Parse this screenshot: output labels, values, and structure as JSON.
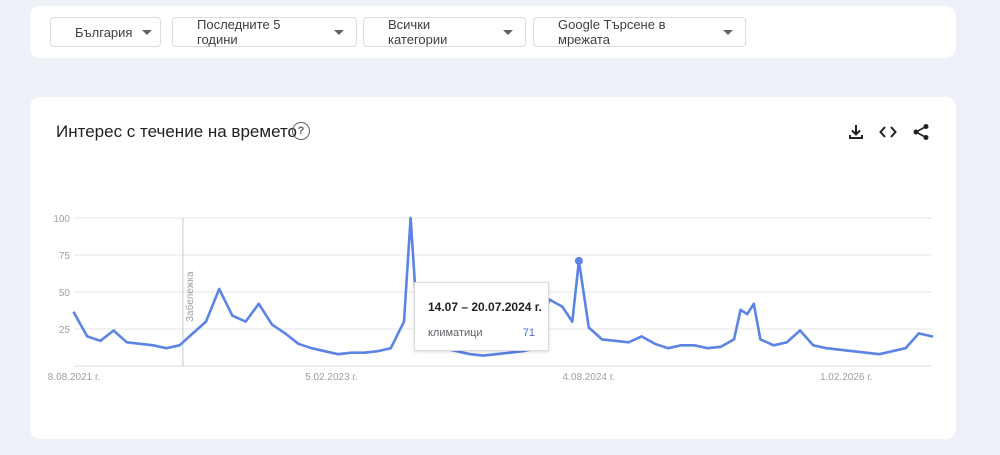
{
  "filters": [
    {
      "label": "България"
    },
    {
      "label": "Последните 5 години"
    },
    {
      "label": "Всички категории"
    },
    {
      "label": "Google Търсене в мрежата"
    }
  ],
  "card": {
    "title": "Интерес с течение на времето",
    "help_glyph": "?",
    "actions": [
      "download-icon",
      "embed-icon",
      "share-icon"
    ]
  },
  "chart_data": {
    "type": "line",
    "title": "",
    "ylim": [
      0,
      100
    ],
    "y_ticks": [
      "100",
      "75",
      "50",
      "25"
    ],
    "x_tick_labels": [
      "8.08.2021 г.",
      "5.02.2023 г.",
      "4.08.2024 г.",
      "1.02.2026 г."
    ],
    "annotation_label": "Забележка",
    "grid": true,
    "series": [
      {
        "name": "климатици",
        "color": "#5b84e4",
        "x": [
          "2021-08-08",
          "2021-09-05",
          "2021-10-03",
          "2021-10-31",
          "2021-11-28",
          "2021-12-26",
          "2022-01-23",
          "2022-02-20",
          "2022-03-20",
          "2022-04-17",
          "2022-05-15",
          "2022-06-12",
          "2022-07-10",
          "2022-08-07",
          "2022-09-04",
          "2022-10-02",
          "2022-10-30",
          "2022-11-27",
          "2022-12-25",
          "2023-01-22",
          "2023-02-19",
          "2023-03-19",
          "2023-04-16",
          "2023-05-14",
          "2023-06-11",
          "2023-07-09",
          "2023-07-23",
          "2023-08-06",
          "2023-09-03",
          "2023-10-01",
          "2023-10-29",
          "2023-11-26",
          "2023-12-24",
          "2024-01-21",
          "2024-02-18",
          "2024-03-17",
          "2024-04-14",
          "2024-05-12",
          "2024-06-09",
          "2024-06-30",
          "2024-07-14",
          "2024-08-04",
          "2024-09-01",
          "2024-09-29",
          "2024-10-27",
          "2024-11-24",
          "2024-12-22",
          "2025-01-19",
          "2025-02-16",
          "2025-03-16",
          "2025-04-13",
          "2025-05-11",
          "2025-06-08",
          "2025-06-22",
          "2025-07-06",
          "2025-07-20",
          "2025-08-03",
          "2025-08-31",
          "2025-09-28",
          "2025-10-26",
          "2025-11-23",
          "2025-12-21",
          "2026-01-18",
          "2026-02-15",
          "2026-03-15",
          "2026-04-12",
          "2026-05-10",
          "2026-06-07",
          "2026-07-05",
          "2026-08-02"
        ],
        "values": [
          36,
          20,
          17,
          24,
          16,
          15,
          14,
          12,
          14,
          22,
          30,
          52,
          34,
          30,
          42,
          28,
          22,
          15,
          12,
          10,
          8,
          9,
          9,
          10,
          12,
          30,
          100,
          32,
          18,
          12,
          10,
          8,
          7,
          8,
          9,
          10,
          12,
          45,
          40,
          30,
          71,
          26,
          18,
          17,
          16,
          20,
          15,
          12,
          14,
          14,
          12,
          13,
          18,
          38,
          35,
          42,
          18,
          14,
          16,
          24,
          14,
          12,
          11,
          10,
          9,
          8,
          10,
          12,
          22,
          20
        ]
      }
    ]
  },
  "tooltip": {
    "title": "14.07 – 20.07.2024 г.",
    "term": "климатици",
    "value": "71"
  }
}
